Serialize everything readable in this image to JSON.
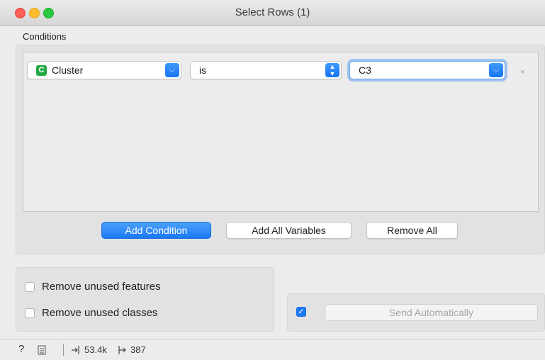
{
  "window": {
    "title": "Select Rows (1)"
  },
  "conditions": {
    "label": "Conditions",
    "rows": [
      {
        "variable_badge": "C",
        "variable": "Cluster",
        "operator": "is",
        "value": "C3",
        "remove": "×"
      }
    ],
    "buttons": {
      "add_condition": "Add Condition",
      "add_all": "Add All Variables",
      "remove_all": "Remove All"
    }
  },
  "options": {
    "remove_unused_features": {
      "label": "Remove unused features",
      "checked": false
    },
    "remove_unused_classes": {
      "label": "Remove unused classes",
      "checked": false
    }
  },
  "commit": {
    "auto_checked": true,
    "checkmark": "✓",
    "button": "Send Automatically"
  },
  "status": {
    "help_icon": "?",
    "input_count": "53.4k",
    "output_count": "387"
  },
  "colors": {
    "accent": "#1d7af6",
    "badge_green": "#25a843"
  }
}
